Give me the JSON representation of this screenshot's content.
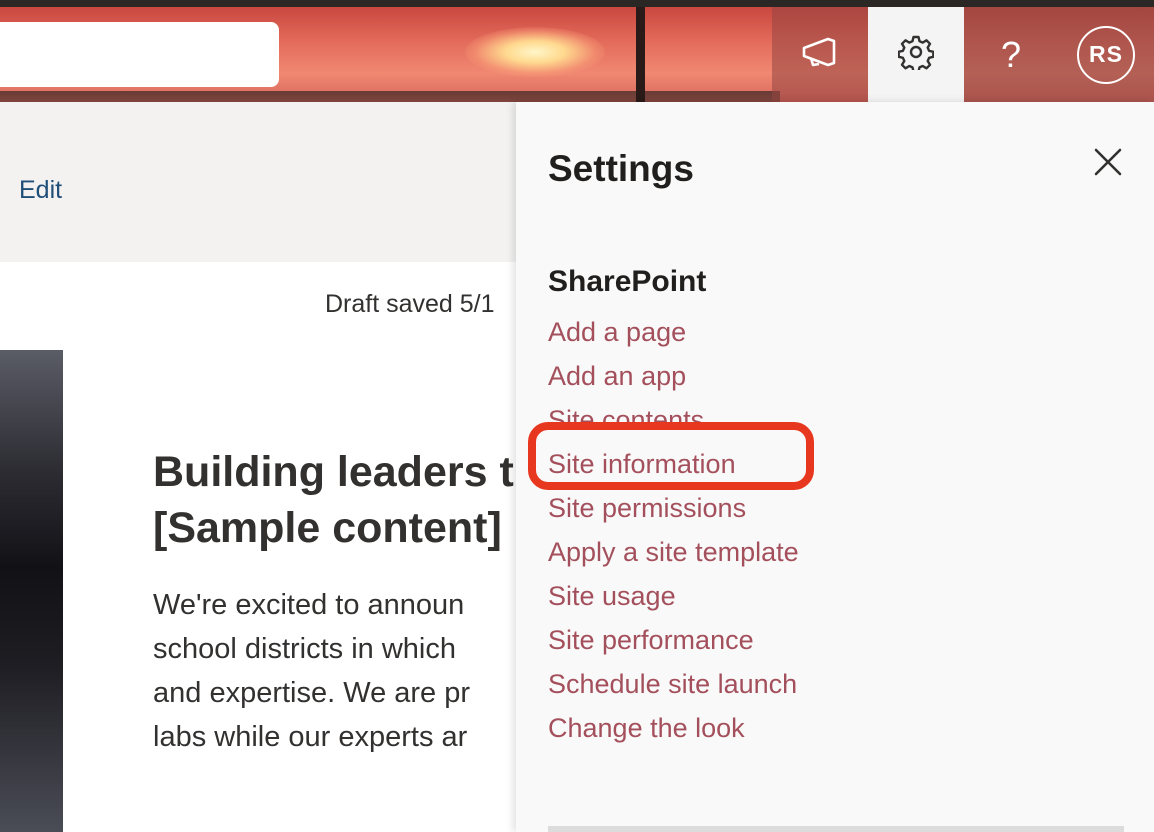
{
  "header": {
    "search_placeholder": "",
    "announce_icon": "megaphone-icon",
    "settings_icon": "gear-icon",
    "help_label": "?",
    "avatar_initials": "RS"
  },
  "command_bar": {
    "edit_label": "Edit"
  },
  "page": {
    "draft_status": "Draft saved 5/1",
    "headline_line1": "Building leaders t",
    "headline_line2": "[Sample content]",
    "body_lines": [
      "We're excited to announ",
      "school districts in which",
      "and expertise. We are pr",
      "labs while our experts ar"
    ]
  },
  "settings_panel": {
    "title": "Settings",
    "close_icon": "close-icon",
    "section_title": "SharePoint",
    "items": [
      "Add a page",
      "Add an app",
      "Site contents",
      "Site information",
      "Site permissions",
      "Apply a site template",
      "Site usage",
      "Site performance",
      "Schedule site launch",
      "Change the look"
    ],
    "highlighted_item": "Site information",
    "link_color": "#a4505c",
    "highlight_color": "#e8371f"
  }
}
